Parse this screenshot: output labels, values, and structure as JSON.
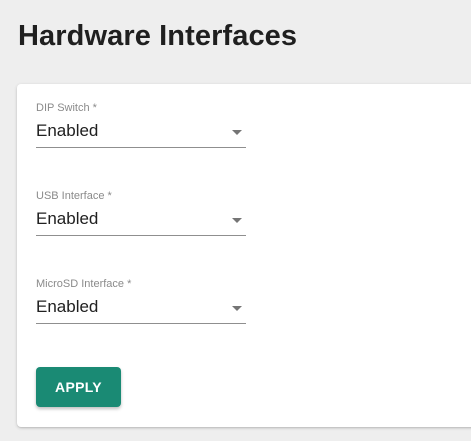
{
  "page": {
    "title": "Hardware Interfaces"
  },
  "form": {
    "fields": [
      {
        "label": "DIP Switch *",
        "value": "Enabled"
      },
      {
        "label": "USB Interface *",
        "value": "Enabled"
      },
      {
        "label": "MicroSD Interface *",
        "value": "Enabled"
      }
    ],
    "apply_label": "APPLY"
  },
  "colors": {
    "accent": "#1a8a74",
    "background": "#eeeeee",
    "card": "#ffffff"
  },
  "icons": {
    "dropdown": "chevron-down-icon"
  }
}
